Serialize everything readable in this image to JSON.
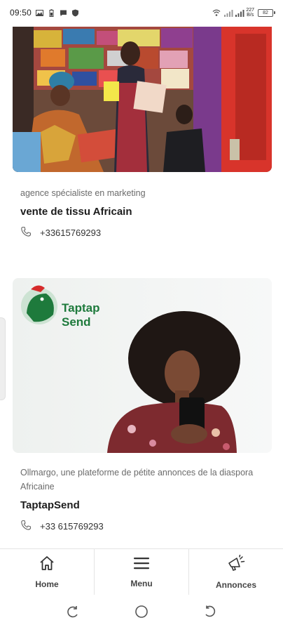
{
  "status_bar": {
    "time": "09:50",
    "speed_value": "227",
    "speed_unit": "B/s",
    "battery": "82"
  },
  "listings": [
    {
      "category": "agence spécialiste en marketing",
      "title": "vente de tissu Africain",
      "phone": "+33615769293"
    },
    {
      "category": "Ollmargo, une plateforme de pétite annonces de la diaspora Africaine",
      "title": "TaptapSend",
      "phone": "+33 615769293",
      "logo_line1": "Taptap",
      "logo_line2": "Send"
    }
  ],
  "bottom_nav": {
    "items": [
      {
        "label": "Home",
        "icon": "home-icon"
      },
      {
        "label": "Menu",
        "icon": "menu-icon"
      },
      {
        "label": "Annonces",
        "icon": "megaphone-icon"
      }
    ]
  },
  "colors": {
    "taptap_green": "#1e7a3c",
    "taptap_red": "#d62b2b",
    "text_muted": "#6b6b6b"
  }
}
